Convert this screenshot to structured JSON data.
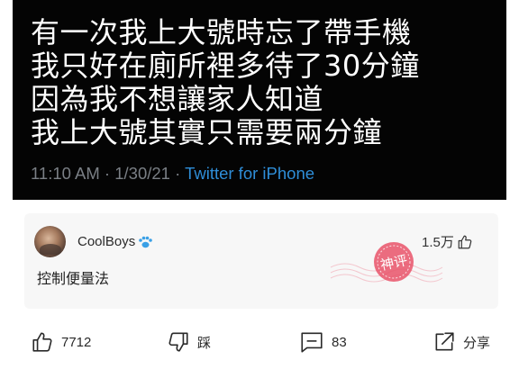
{
  "tweet": {
    "lines": [
      "有一次我上大號時忘了帶手機",
      "我只好在廁所裡多待了30分鐘",
      "因為我不想讓家人知道",
      "我上大號其實只需要兩分鐘"
    ],
    "timestamp": "11:10 AM · 1/30/21 · ",
    "source": "Twitter for iPhone"
  },
  "comment": {
    "username": "CoolBoys",
    "user_badge_icon": "paw-icon",
    "like_count": "1.5万",
    "text": "控制便量法",
    "stamp_text": "神评"
  },
  "actions": {
    "like_count": "7712",
    "dislike_label": "踩",
    "comment_count": "83",
    "share_label": "分享"
  },
  "colors": {
    "tweet_bg": "#040404",
    "source_link": "#2f8ed8",
    "card_bg": "#f7f7f7",
    "stamp": "#e8425a",
    "paw": "#3aa0e6"
  }
}
